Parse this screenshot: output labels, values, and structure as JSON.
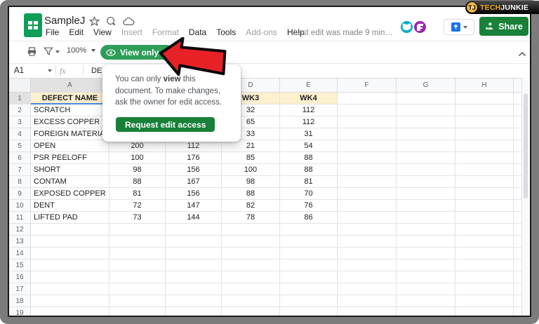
{
  "branding": {
    "monogram": "TJ",
    "tech": "TECH",
    "junkie": "JUNKIE"
  },
  "titlebar": {
    "title": "SampleJ",
    "icons": [
      "star-icon",
      "circle-plus-icon",
      "cloud-status-icon"
    ]
  },
  "menubar": {
    "items": [
      {
        "label": "File",
        "enabled": true
      },
      {
        "label": "Edit",
        "enabled": true
      },
      {
        "label": "View",
        "enabled": true
      },
      {
        "label": "Insert",
        "enabled": false
      },
      {
        "label": "Format",
        "enabled": false
      },
      {
        "label": "Data",
        "enabled": true
      },
      {
        "label": "Tools",
        "enabled": true
      },
      {
        "label": "Add-ons",
        "enabled": false
      },
      {
        "label": "Help",
        "enabled": true
      }
    ],
    "last_edit": "Last edit was made 9 min…"
  },
  "collab": {
    "share_label": "Share"
  },
  "toolbar": {
    "zoom_level": "100%",
    "view_only_label": "View only"
  },
  "formula_bar": {
    "cell_ref": "A1",
    "fx_label": "fx",
    "visible_content": "DE"
  },
  "tooltip": {
    "text_before": "You can only ",
    "text_bold": "view",
    "text_after": " this document. To make changes, ask the owner for edit access.",
    "button_label": "Request edit access"
  },
  "grid": {
    "column_letters": [
      "A",
      "B",
      "C",
      "D",
      "E",
      "F",
      "G",
      "H"
    ],
    "row_count": 19,
    "selected_cell": "A1",
    "header_row": {
      "A": "DEFECT NAME",
      "D": "WK3",
      "E": "WK4"
    },
    "data_rows": [
      {
        "row": 2,
        "A": "SCRATCH",
        "D": "32",
        "E": "112"
      },
      {
        "row": 3,
        "A": "EXCESS COPPER",
        "D": "65",
        "E": "112"
      },
      {
        "row": 4,
        "A": "FOREIGN MATERIAL",
        "D": "33",
        "E": "31"
      },
      {
        "row": 5,
        "A": "OPEN",
        "B": "200",
        "C": "112",
        "D": "21",
        "E": "54"
      },
      {
        "row": 6,
        "A": "PSR PEELOFF",
        "B": "100",
        "C": "176",
        "D": "85",
        "E": "88"
      },
      {
        "row": 7,
        "A": "SHORT",
        "B": "98",
        "C": "156",
        "D": "100",
        "E": "88"
      },
      {
        "row": 8,
        "A": "CONTAM",
        "B": "88",
        "C": "167",
        "D": "98",
        "E": "81"
      },
      {
        "row": 9,
        "A": "EXPOSED COPPER",
        "B": "81",
        "C": "156",
        "D": "88",
        "E": "70"
      },
      {
        "row": 10,
        "A": "DENT",
        "B": "72",
        "C": "147",
        "D": "82",
        "E": "76"
      },
      {
        "row": 11,
        "A": "LIFTED PAD",
        "B": "73",
        "C": "144",
        "D": "78",
        "E": "86"
      }
    ]
  },
  "colors": {
    "logo_green": "#0f9d58",
    "share_green": "#188038",
    "view_only_green": "#2f9d58",
    "request_green": "#188038",
    "header_fill": "#fdf0ce",
    "selection_blue": "#4a86e8",
    "arrow_red": "#e82127",
    "tech_gold": "#eda928"
  }
}
